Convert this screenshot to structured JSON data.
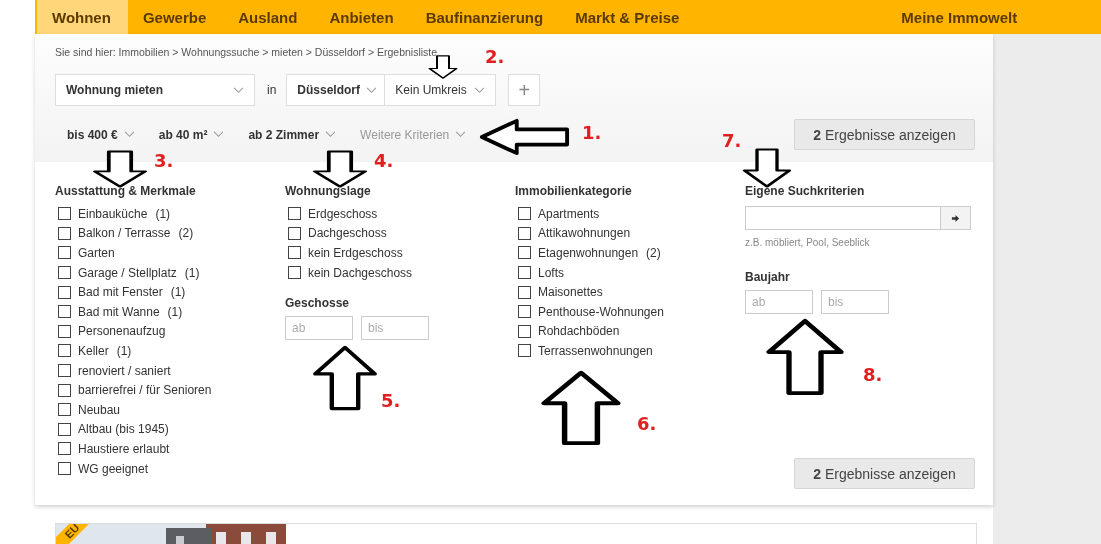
{
  "nav": {
    "tabs": [
      {
        "label": "Wohnen",
        "selected": true
      },
      {
        "label": "Gewerbe",
        "selected": false
      },
      {
        "label": "Ausland",
        "selected": false
      },
      {
        "label": "Anbieten",
        "selected": false
      },
      {
        "label": "Baufinanzierung",
        "selected": false
      },
      {
        "label": "Markt & Preise",
        "selected": false
      }
    ],
    "account": "Meine Immowelt"
  },
  "breadcrumb": "Sie sind hier: Immobilien > Wohnungssuche > mieten > Düsseldorf > Ergebnisliste",
  "search": {
    "type_select": "Wohnung mieten",
    "in_label": "in",
    "city_select": "Düsseldorf",
    "radius_select": "Kein Umkreis",
    "add_button": "+"
  },
  "quick_filters": [
    {
      "label": "bis 400 €",
      "kind": "main"
    },
    {
      "label": "ab 40 m²",
      "kind": "main"
    },
    {
      "label": "ab 2 Zimmer",
      "kind": "main"
    },
    {
      "label": "Weitere Kriterien",
      "kind": "more"
    }
  ],
  "results_button": "**2** Ergebnisse anzeigen",
  "columns": [
    {
      "sections": [
        {
          "kind": "checklist",
          "title": "Ausstattung & Merkmale",
          "items": [
            {
              "label": "Einbauküche",
              "count": "(1)",
              "checked": false
            },
            {
              "label": "Balkon / Terrasse",
              "count": "(2)",
              "checked": false
            },
            {
              "label": "Garten",
              "checked": false
            },
            {
              "label": "Garage / Stellplatz",
              "count": "(1)",
              "checked": false
            },
            {
              "label": "Bad mit Fenster",
              "count": "(1)",
              "checked": false
            },
            {
              "label": "Bad mit Wanne",
              "count": "(1)",
              "checked": false
            },
            {
              "label": "Personenaufzug",
              "checked": false
            },
            {
              "label": "Keller",
              "count": "(1)",
              "checked": false
            },
            {
              "label": "renoviert / saniert",
              "checked": false
            },
            {
              "label": "barrierefrei / für Senioren",
              "checked": false
            },
            {
              "label": "Neubau",
              "checked": false
            },
            {
              "label": "Altbau (bis 1945)",
              "checked": false
            },
            {
              "label": "Haustiere erlaubt",
              "checked": false
            },
            {
              "label": "WG geeignet",
              "checked": false
            }
          ]
        }
      ]
    },
    {
      "sections": [
        {
          "kind": "checklist",
          "title": "Wohnungslage",
          "items": [
            {
              "label": "Erdgeschoss",
              "checked": false
            },
            {
              "label": "Dachgeschoss",
              "checked": false
            },
            {
              "label": "kein Erdgeschoss",
              "checked": false
            },
            {
              "label": "kein Dachgeschoss",
              "checked": false
            }
          ]
        },
        {
          "kind": "range",
          "title": "Geschosse",
          "from_placeholder": "ab",
          "to_placeholder": "bis"
        }
      ]
    },
    {
      "sections": [
        {
          "kind": "checklist",
          "title": "Immobilienkategorie",
          "items": [
            {
              "label": "Apartments",
              "checked": false
            },
            {
              "label": "Attikawohnungen",
              "checked": false
            },
            {
              "label": "Etagenwohnungen",
              "count": "(2)",
              "checked": false
            },
            {
              "label": "Lofts",
              "checked": false
            },
            {
              "label": "Maisonettes",
              "checked": false
            },
            {
              "label": "Penthouse-Wohnungen",
              "checked": false
            },
            {
              "label": "Rohdachböden",
              "checked": false
            },
            {
              "label": "Terrassenwohnungen",
              "checked": false
            }
          ]
        }
      ]
    },
    {
      "sections": [
        {
          "kind": "text_search",
          "title": "Eigene Suchkriterien",
          "hint": "z.B. möbliert, Pool, Seeblick"
        },
        {
          "kind": "range",
          "title": "Baujahr",
          "from_placeholder": "ab",
          "to_placeholder": "bis"
        }
      ]
    }
  ],
  "bottom_button": "**2** Ergebnisse anzeigen",
  "result_card": {
    "badge": "EU"
  },
  "annotations": [
    {
      "number": "1.",
      "kind": "left"
    },
    {
      "number": "2.",
      "kind": "down"
    },
    {
      "number": "3.",
      "kind": "down"
    },
    {
      "number": "4.",
      "kind": "down"
    },
    {
      "number": "5.",
      "kind": "up"
    },
    {
      "number": "6.",
      "kind": "up"
    },
    {
      "number": "7.",
      "kind": "down"
    },
    {
      "number": "8.",
      "kind": "up"
    }
  ]
}
